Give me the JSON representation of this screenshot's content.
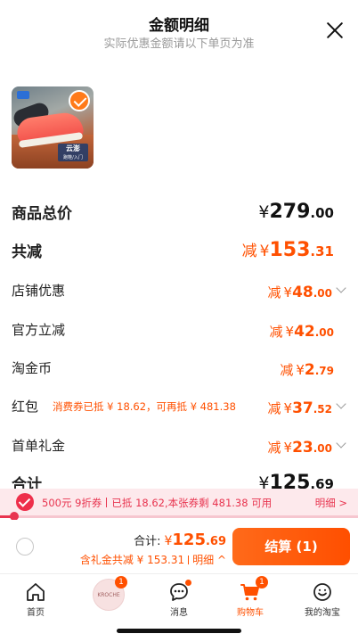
{
  "header": {
    "title": "金额明细",
    "subtitle": "实际优惠金额请以下单页为准"
  },
  "product": {
    "image_tag_main": "云澎",
    "image_tag_sub": "跑鞋/入门"
  },
  "rows": [
    {
      "label": "商品总价",
      "prefix": "",
      "currency": "¥",
      "int": "279",
      "dec": ".00",
      "style": "total"
    },
    {
      "label": "共减",
      "prefix": "减",
      "currency": "¥",
      "int": "153",
      "dec": ".31",
      "style": "large"
    },
    {
      "label": "店铺优惠",
      "prefix": "减",
      "currency": "¥",
      "int": "48",
      "dec": ".00",
      "style": "arrow"
    },
    {
      "label": "官方立减",
      "prefix": "减",
      "currency": "¥",
      "int": "42",
      "dec": ".00",
      "style": "plain"
    },
    {
      "label": "淘金币",
      "prefix": "减",
      "currency": "¥",
      "int": "2",
      "dec": ".79",
      "style": "plain"
    },
    {
      "label": "红包",
      "note": "消费券已抵 ¥ 18.62，可再抵 ¥ 481.38",
      "prefix": "减",
      "currency": "¥",
      "int": "37",
      "dec": ".52",
      "style": "arrow"
    },
    {
      "label": "首单礼金",
      "prefix": "减",
      "currency": "¥",
      "int": "23",
      "dec": ".00",
      "style": "arrow"
    },
    {
      "label": "合计",
      "prefix": "",
      "currency": "¥",
      "int": "125",
      "dec": ".69",
      "style": "total"
    }
  ],
  "coupon_bar": {
    "text_a": "500元 9折券",
    "text_b": "已抵 18.62,本张券剩 481.38 可用",
    "detail": "明细 >",
    "progress": 0.04
  },
  "checkout": {
    "sum_label": "合计:",
    "currency": "¥",
    "int": "125",
    "dec": ".69",
    "discount_text": "含礼金共减 ¥ 153.31",
    "detail": "明细 ^",
    "pay_label": "结算 (1)"
  },
  "tabbar": [
    {
      "label": "首页",
      "icon": "home-icon"
    },
    {
      "label": "",
      "icon": "avatar",
      "badge": "1",
      "brand": "KROCHE"
    },
    {
      "label": "消息",
      "icon": "chat-icon",
      "dot": true
    },
    {
      "label": "购物车",
      "icon": "cart-icon",
      "badge": "1",
      "active": true
    },
    {
      "label": "我的淘宝",
      "icon": "smile-icon"
    }
  ],
  "colors": {
    "accent": "#ff5000",
    "coupon": "#e8344f"
  }
}
